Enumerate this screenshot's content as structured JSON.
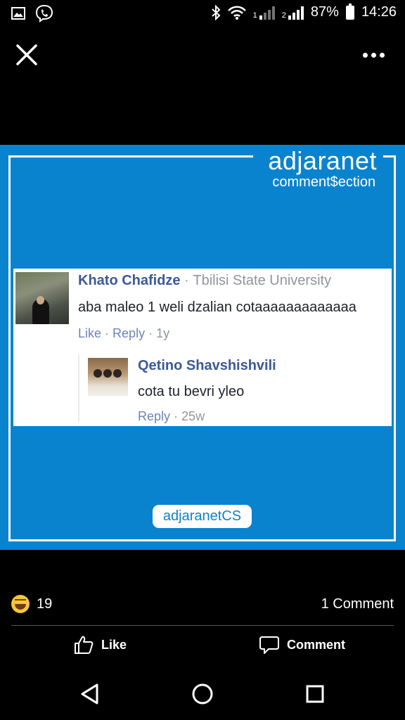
{
  "status_bar": {
    "icons": [
      "gallery-icon",
      "viber-icon",
      "bluetooth-icon",
      "wifi-icon",
      "signal-1-icon",
      "signal-2-icon",
      "battery-icon"
    ],
    "sim1_label": "1",
    "sim2_label": "2",
    "battery": "87%",
    "time": "14:26"
  },
  "toolbar": {
    "close_icon": "close-icon",
    "more_icon": "more-options-icon"
  },
  "post_image": {
    "background_color": "#0a83cf",
    "brand_name": "adjaranet",
    "brand_sub": "comment$ection",
    "watermark": "adjaranetCS",
    "comment": {
      "author": "Khato Chafidze",
      "separator": "·",
      "affiliation": "Tbilisi State University",
      "text": "aba maleo 1 weli dzalian cotaaaaaaaaaaaaa",
      "like": "Like",
      "reply": "Reply",
      "time": "1y"
    },
    "reply": {
      "author": "Qetino Shavshishvili",
      "text": "cota tu bevri yleo",
      "reply": "Reply",
      "time": "25w"
    }
  },
  "footer": {
    "reaction_icon": "haha-emoji-icon",
    "reaction_count": "19",
    "comment_count": "1 Comment",
    "like_label": "Like",
    "comment_label": "Comment"
  },
  "navbar": {
    "icons": [
      "back-icon",
      "home-icon",
      "recents-icon"
    ]
  }
}
